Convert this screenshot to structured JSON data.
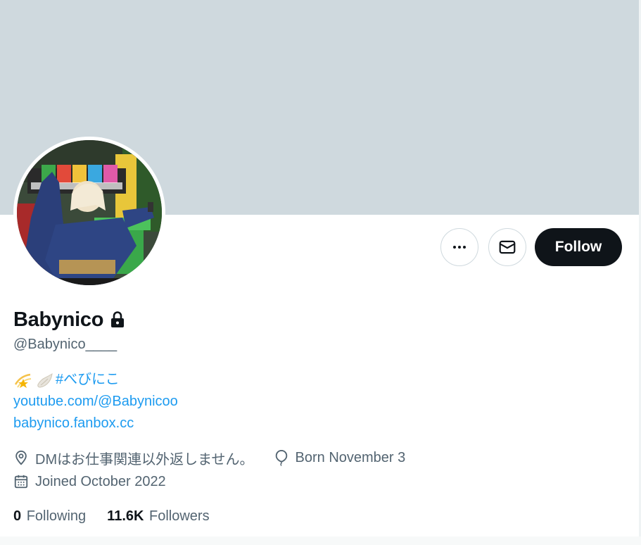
{
  "profile": {
    "display_name": "Babynico",
    "handle": "@Babynico____",
    "protected": true
  },
  "actions": {
    "more_icon": "ellipsis-icon",
    "message_icon": "envelope-icon",
    "follow_label": "Follow"
  },
  "bio": {
    "emojis": [
      "dizzy-star-emoji",
      "wing-emoji"
    ],
    "hashtag": "#べびにこ",
    "links": [
      "youtube.com/@Babynicoo",
      "babynico.fanbox.cc"
    ]
  },
  "meta": {
    "location": "DMはお仕事関連以外返しません。",
    "birthday": "Born November 3",
    "joined": "Joined October 2022"
  },
  "stats": {
    "following_count": "0",
    "following_label": "Following",
    "followers_count": "11.6K",
    "followers_label": "Followers"
  },
  "colors": {
    "banner": "#cfd9de",
    "text_primary": "#0f1419",
    "text_secondary": "#536471",
    "link": "#1d9bf0",
    "follow_button": "#0f1419"
  }
}
